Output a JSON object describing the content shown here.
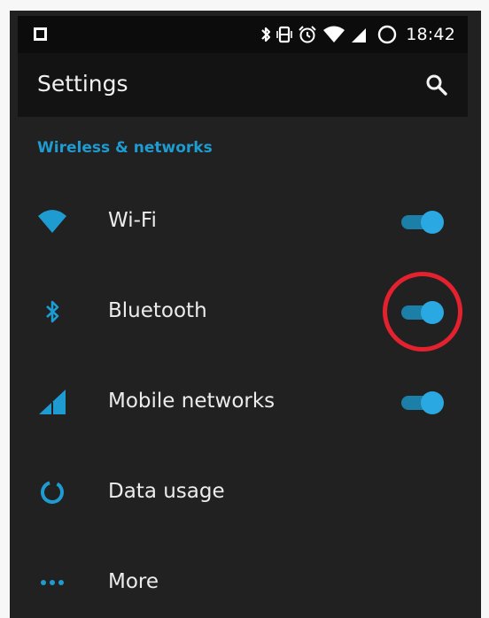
{
  "status_bar": {
    "time": "18:42",
    "icons": [
      "stop-square-icon",
      "bluetooth-icon",
      "vibrate-icon",
      "alarm-icon",
      "wifi-icon",
      "signal-icon",
      "battery-loading-icon"
    ]
  },
  "app_bar": {
    "title": "Settings",
    "search_icon": "search-icon"
  },
  "section": {
    "header": "Wireless & networks"
  },
  "rows": [
    {
      "label": "Wi-Fi",
      "icon": "wifi-icon",
      "toggle": true
    },
    {
      "label": "Bluetooth",
      "icon": "bluetooth-icon",
      "toggle": true
    },
    {
      "label": "Mobile networks",
      "icon": "signal-icon",
      "toggle": true
    },
    {
      "label": "Data usage",
      "icon": "data-usage-icon",
      "toggle": null
    },
    {
      "label": "More",
      "icon": "more-icon",
      "toggle": null
    }
  ],
  "colors": {
    "accent": "#1e9bd1",
    "background": "#212121",
    "highlight": "#e4212e"
  }
}
